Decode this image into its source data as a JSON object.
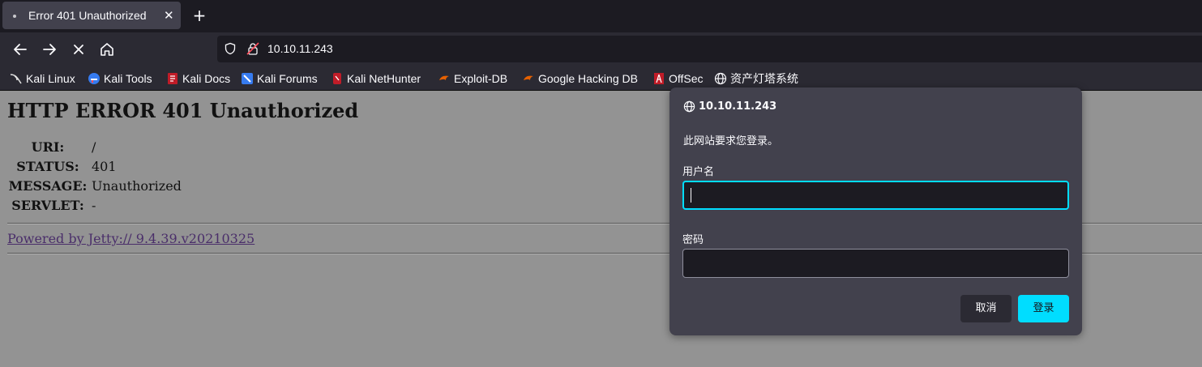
{
  "tab": {
    "title": "Error 401 Unauthorized",
    "close": "✕",
    "new_tab": "+"
  },
  "address": {
    "url": "10.10.11.243"
  },
  "bookmarks": [
    {
      "label": "Kali Linux",
      "icon": "kali-dragon-icon"
    },
    {
      "label": "Kali Tools",
      "icon": "kali-tools-icon"
    },
    {
      "label": "Kali Docs",
      "icon": "kali-docs-icon"
    },
    {
      "label": "Kali Forums",
      "icon": "kali-forums-icon"
    },
    {
      "label": "Kali NetHunter",
      "icon": "kali-nethunter-icon"
    },
    {
      "label": "Exploit-DB",
      "icon": "exploit-db-icon"
    },
    {
      "label": "Google Hacking DB",
      "icon": "ghdb-icon"
    },
    {
      "label": "OffSec",
      "icon": "offsec-icon"
    },
    {
      "label": "资产灯塔系统",
      "icon": "globe-icon"
    }
  ],
  "page": {
    "heading": "HTTP ERROR 401 Unauthorized",
    "rows": [
      {
        "key": "URI:",
        "value": "/"
      },
      {
        "key": "STATUS:",
        "value": "401"
      },
      {
        "key": "MESSAGE:",
        "value": "Unauthorized"
      },
      {
        "key": "SERVLET:",
        "value": "-"
      }
    ],
    "powered_by": "Powered by Jetty:// 9.4.39.v20210325"
  },
  "dialog": {
    "host": "10.10.11.243",
    "message": "此网站要求您登录。",
    "username_label": "用户名",
    "username_value": "",
    "password_label": "密码",
    "password_value": "",
    "cancel_label": "取消",
    "login_label": "登录"
  },
  "colors": {
    "accent": "#00ddff",
    "toolbar": "#2b2a33",
    "page_bg": "#939393",
    "dialog_bg": "#42414d"
  }
}
